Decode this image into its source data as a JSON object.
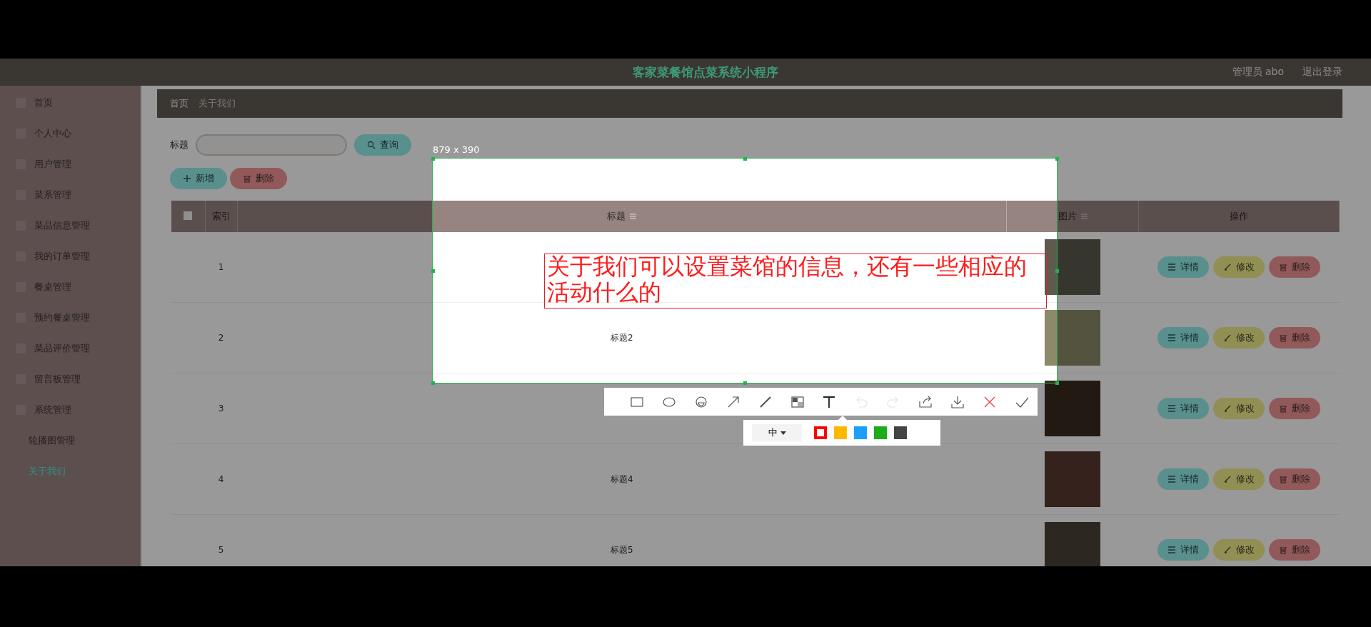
{
  "app_header": {
    "title": "客家菜餐馆点菜系统小程序",
    "user": "管理员 abo",
    "logout": "退出登录"
  },
  "sidebar": {
    "items": [
      {
        "label": "首页",
        "icon": true,
        "selected": false
      },
      {
        "label": "个人中心",
        "icon": true,
        "selected": false
      },
      {
        "label": "用户管理",
        "icon": true,
        "selected": false
      },
      {
        "label": "菜系管理",
        "icon": true,
        "selected": false
      },
      {
        "label": "菜品信息管理",
        "icon": true,
        "selected": false
      },
      {
        "label": "我的订单管理",
        "icon": true,
        "selected": false
      },
      {
        "label": "餐桌管理",
        "icon": true,
        "selected": false
      },
      {
        "label": "预约餐桌管理",
        "icon": true,
        "selected": false
      },
      {
        "label": "菜品评价管理",
        "icon": true,
        "selected": false
      },
      {
        "label": "留言板管理",
        "icon": true,
        "selected": false
      },
      {
        "label": "系统管理",
        "icon": true,
        "selected": false
      },
      {
        "label": "轮播图管理",
        "icon": false,
        "selected": false
      },
      {
        "label": "关于我们",
        "icon": false,
        "selected": true
      }
    ]
  },
  "breadcrumb": [
    "首页",
    "关于我们"
  ],
  "search": {
    "label": "标题",
    "button": "查询"
  },
  "toolbar_buttons": [
    {
      "label": "新增",
      "kind": "add"
    },
    {
      "label": "删除",
      "kind": "delete"
    }
  ],
  "table": {
    "columns": [
      {
        "kind": "checkbox",
        "checked": false
      },
      {
        "label": "索引",
        "sortable": false
      },
      {
        "label": "标题",
        "sortable": true
      },
      {
        "label": "图片",
        "sortable": true
      },
      {
        "label": "操作",
        "sortable": false
      }
    ],
    "rows": [
      {
        "index": "1",
        "actions": [
          {
            "label": "详情",
            "kind": "detail"
          },
          {
            "label": "修改",
            "kind": "edit"
          },
          {
            "label": "删除",
            "kind": "delete"
          }
        ]
      },
      {
        "index": "2",
        "title": "标题2",
        "actions": [
          {
            "label": "详情",
            "kind": "detail"
          },
          {
            "label": "修改",
            "kind": "edit"
          },
          {
            "label": "删除",
            "kind": "delete"
          }
        ]
      },
      {
        "index": "3",
        "actions": [
          {
            "label": "详情",
            "kind": "detail"
          },
          {
            "label": "修改",
            "kind": "edit"
          },
          {
            "label": "删除",
            "kind": "delete"
          }
        ]
      },
      {
        "index": "4",
        "title": "标题4",
        "actions": [
          {
            "label": "详情",
            "kind": "detail"
          },
          {
            "label": "修改",
            "kind": "edit"
          },
          {
            "label": "删除",
            "kind": "delete"
          }
        ]
      },
      {
        "index": "5",
        "title": "标题5",
        "actions": [
          {
            "label": "详情",
            "kind": "detail"
          },
          {
            "label": "修改",
            "kind": "edit"
          },
          {
            "label": "删除",
            "kind": "delete"
          }
        ]
      }
    ]
  },
  "screenshot_tool": {
    "size_label": "879 x 390",
    "annotation": "关于我们可以设置菜馆的信息，还有一些相应的活动什么的",
    "tools": [
      {
        "kind": "rectangle",
        "selected": false,
        "disabled": false
      },
      {
        "kind": "ellipse",
        "selected": false,
        "disabled": false
      },
      {
        "kind": "emoji",
        "selected": false,
        "disabled": false
      },
      {
        "kind": "arrow",
        "selected": false,
        "disabled": false
      },
      {
        "kind": "pen",
        "selected": false,
        "disabled": false
      },
      {
        "kind": "mosaic",
        "selected": false,
        "disabled": false
      },
      {
        "kind": "text",
        "selected": true,
        "disabled": false
      },
      {
        "kind": "undo",
        "selected": false,
        "disabled": true
      },
      {
        "kind": "redo",
        "selected": false,
        "disabled": true
      },
      {
        "kind": "share",
        "selected": false,
        "disabled": false
      },
      {
        "kind": "download",
        "selected": false,
        "disabled": false
      },
      {
        "kind": "cancel",
        "selected": false,
        "disabled": false
      },
      {
        "kind": "confirm",
        "selected": false,
        "disabled": false
      }
    ],
    "font_size": "中",
    "colors": [
      {
        "color": "#ff0000",
        "selected": true
      },
      {
        "color": "#ffb800",
        "selected": false
      },
      {
        "color": "#1e9fff",
        "selected": false
      },
      {
        "color": "#1aad19",
        "selected": false
      },
      {
        "color": "#444444",
        "selected": false
      }
    ]
  }
}
